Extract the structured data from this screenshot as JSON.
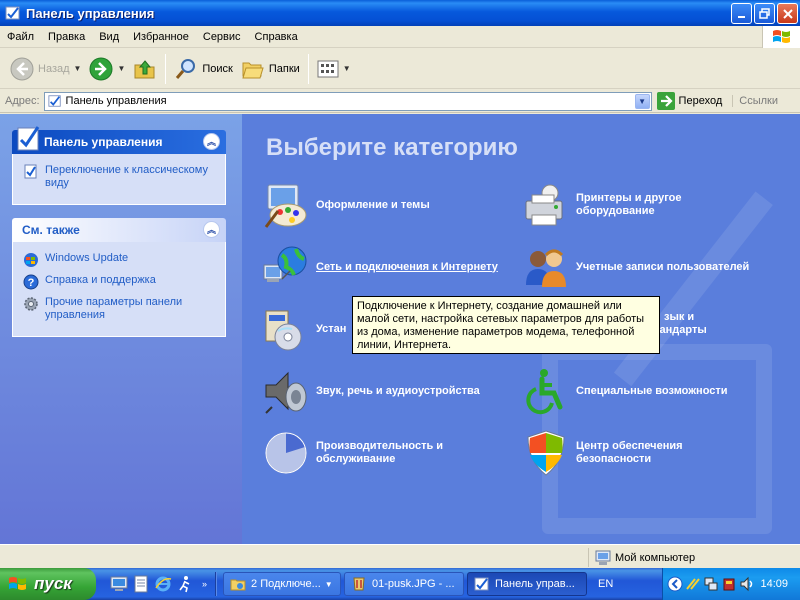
{
  "window": {
    "title": "Панель управления"
  },
  "menu": [
    "Файл",
    "Правка",
    "Вид",
    "Избранное",
    "Сервис",
    "Справка"
  ],
  "toolbar": {
    "back_label": "Назад",
    "search_label": "Поиск",
    "folders_label": "Папки"
  },
  "address": {
    "label": "Адрес:",
    "value": "Панель управления",
    "go_label": "Переход",
    "links_label": "Ссылки"
  },
  "sidebar": {
    "panel1": {
      "title": "Панель управления",
      "items": [
        {
          "label": "Переключение к классическому виду",
          "icon": "classic-view-icon"
        }
      ]
    },
    "panel2": {
      "title": "См. также",
      "items": [
        {
          "label": "Windows Update",
          "icon": "windows-update-icon"
        },
        {
          "label": "Справка и поддержка",
          "icon": "help-icon"
        },
        {
          "label": "Прочие параметры панели управления",
          "icon": "gear-icon"
        }
      ]
    }
  },
  "main": {
    "title": "Выберите категорию",
    "categories": [
      {
        "label": "Оформление и темы",
        "icon": "appearance-themes-icon"
      },
      {
        "label": "Принтеры и другое оборудование",
        "icon": "printer-icon"
      },
      {
        "label": "Сеть и подключения к Интернету",
        "icon": "network-globe-icon"
      },
      {
        "label": "Учетные записи пользователей",
        "icon": "user-accounts-icon"
      },
      {
        "label": "Устан",
        "icon": "add-remove-programs-icon"
      },
      {
        "label": "зык и",
        "label2": "стандарты",
        "icon": "regional-settings-icon"
      },
      {
        "label": "Звук, речь и аудиоустройства",
        "icon": "speaker-icon"
      },
      {
        "label": "Специальные возможности",
        "icon": "accessibility-icon"
      },
      {
        "label": "Производительность и обслуживание",
        "icon": "performance-icon"
      },
      {
        "label": "Центр обеспечения безопасности",
        "icon": "security-shield-icon"
      }
    ],
    "tooltip": "Подключение к Интернету, создание домашней или малой сети, настройка сетевых параметров для работы из дома, изменение параметров модема, телефонной линии, Интернета."
  },
  "statusbar": {
    "computer_label": "Мой компьютер"
  },
  "taskbar": {
    "start_label": "пуск",
    "tasks": [
      {
        "label": "2 Подключе...",
        "icon": "network-folder-icon"
      },
      {
        "label": "01-pusk.JPG - ...",
        "icon": "paint-icon"
      },
      {
        "label": "Панель управ...",
        "icon": "control-panel-icon"
      }
    ],
    "lang": "EN",
    "clock": "14:09"
  },
  "colors": {
    "accent": "#215dc6",
    "content_bg": "#5a7edc",
    "panel_body": "#d6dff7"
  }
}
